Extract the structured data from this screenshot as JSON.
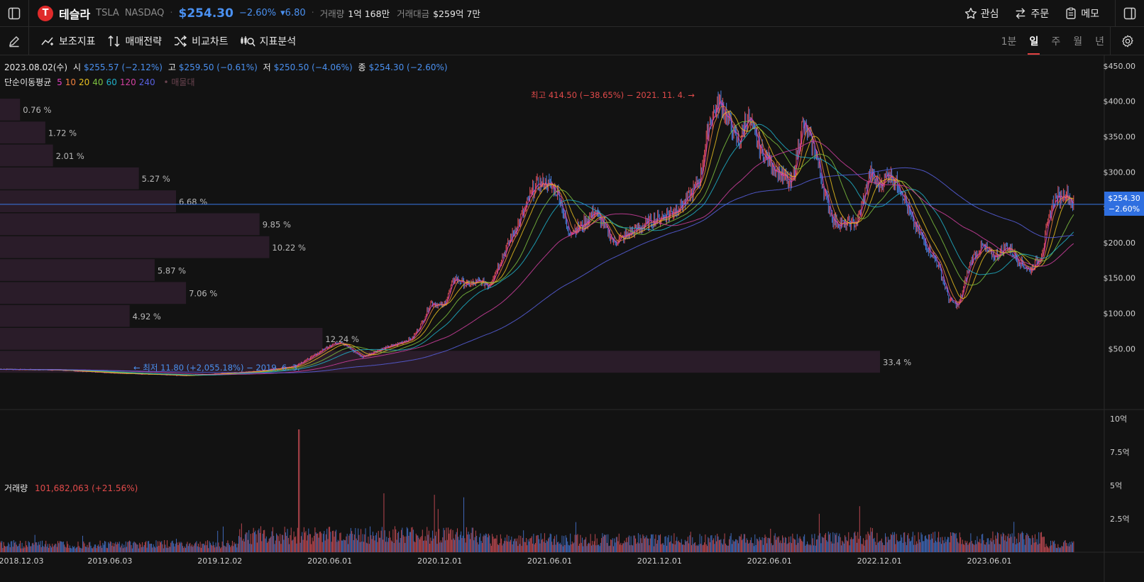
{
  "header": {
    "stock_name": "테슬라",
    "ticker": "TSLA",
    "exchange": "NASDAQ",
    "price": "$254.30",
    "change_pct": "−2.60%",
    "change_amt": "▾6.80",
    "volume_label": "거래량",
    "volume_value": "1억 168만",
    "amount_label": "거래대금",
    "amount_value": "$259억 7만",
    "actions": [
      "관심",
      "주문",
      "메모"
    ]
  },
  "toolbar": {
    "tools": [
      "보조지표",
      "매매전략",
      "비교차트",
      "지표분석"
    ],
    "timeframes": [
      "1분",
      "일",
      "주",
      "월",
      "년"
    ],
    "active_timeframe": "일"
  },
  "legend": {
    "date": "2023.08.02(수)",
    "open_label": "시",
    "open": "$255.57 (−2.12%)",
    "high_label": "고",
    "high": "$259.50 (−0.61%)",
    "low_label": "저",
    "low": "$250.50 (−4.06%)",
    "close_label": "종",
    "close": "$254.30 (−2.60%)",
    "ma_label": "단순이동평균",
    "ma_periods": [
      {
        "p": "5",
        "color": "#e040c0"
      },
      {
        "p": "10",
        "color": "#f0803c"
      },
      {
        "p": "20",
        "color": "#e8c020"
      },
      {
        "p": "40",
        "color": "#7cc040"
      },
      {
        "p": "60",
        "color": "#20b0c8"
      },
      {
        "p": "120",
        "color": "#d040a0"
      },
      {
        "p": "240",
        "color": "#5860e0"
      }
    ],
    "ma_extra": "• 매물대"
  },
  "annotations": {
    "high": "최고 414.50 (−38.65%) − 2021. 11. 4. →",
    "low": "← 최저 11.80 (+2,055.18%) − 2019. 6. 3."
  },
  "current_badge": {
    "price": "$254.30",
    "pct": "−2.60%"
  },
  "volume_legend": {
    "label": "거래량",
    "value": "101,682,063 (+21.56%)"
  },
  "chart_data": {
    "type": "candlestick",
    "price_axis": {
      "ticks": [
        "$450.00",
        "$400.00",
        "$350.00",
        "$300.00",
        "$250.00",
        "$200.00",
        "$150.00",
        "$100.00",
        "$50.00"
      ],
      "values": [
        450,
        400,
        350,
        300,
        250,
        200,
        150,
        100,
        50
      ],
      "range": [
        -35,
        465
      ]
    },
    "volume_axis": {
      "ticks": [
        "10억",
        "7.5억",
        "5억",
        "2.5억"
      ],
      "values": [
        1000,
        750,
        500,
        250
      ],
      "unit": "백만주"
    },
    "x_axis": {
      "labels": [
        "2018.12.03",
        "2019.06.03",
        "2019.12.02",
        "2020.06.01",
        "2020.12.01",
        "2021.06.01",
        "2021.12.01",
        "2022.06.01",
        "2022.12.01",
        "2023.06.01"
      ]
    },
    "close_path": [
      [
        0,
        21
      ],
      [
        3,
        20
      ],
      [
        6,
        16
      ],
      [
        8,
        14
      ],
      [
        10,
        12
      ],
      [
        12,
        15
      ],
      [
        14,
        18
      ],
      [
        16,
        25
      ],
      [
        17,
        38
      ],
      [
        18,
        55
      ],
      [
        18.6,
        60
      ],
      [
        19.2,
        48
      ],
      [
        19.8,
        38
      ],
      [
        20.5,
        47
      ],
      [
        21.5,
        55
      ],
      [
        22.5,
        65
      ],
      [
        23,
        85
      ],
      [
        23.5,
        115
      ],
      [
        24.2,
        110
      ],
      [
        24.8,
        150
      ],
      [
        25.5,
        140
      ],
      [
        26.2,
        145
      ],
      [
        26.7,
        140
      ],
      [
        27.5,
        185
      ],
      [
        28.5,
        240
      ],
      [
        29.2,
        280
      ],
      [
        29.8,
        285
      ],
      [
        30.5,
        270
      ],
      [
        31,
        215
      ],
      [
        31.8,
        225
      ],
      [
        32.5,
        245
      ],
      [
        33.5,
        200
      ],
      [
        34.5,
        215
      ],
      [
        35.5,
        230
      ],
      [
        36.5,
        240
      ],
      [
        37.5,
        260
      ],
      [
        38.2,
        290
      ],
      [
        38.7,
        370
      ],
      [
        39.3,
        400
      ],
      [
        39.8,
        370
      ],
      [
        40.3,
        340
      ],
      [
        40.8,
        380
      ],
      [
        41.5,
        330
      ],
      [
        42.5,
        300
      ],
      [
        43.2,
        280
      ],
      [
        43.8,
        370
      ],
      [
        44.5,
        330
      ],
      [
        45,
        270
      ],
      [
        45.5,
        230
      ],
      [
        46.2,
        225
      ],
      [
        46.8,
        230
      ],
      [
        47.5,
        300
      ],
      [
        48,
        280
      ],
      [
        48.5,
        300
      ],
      [
        49.2,
        275
      ],
      [
        49.8,
        230
      ],
      [
        50.5,
        200
      ],
      [
        51.2,
        170
      ],
      [
        51.8,
        120
      ],
      [
        52.3,
        110
      ],
      [
        53,
        175
      ],
      [
        53.6,
        195
      ],
      [
        54.3,
        180
      ],
      [
        55,
        195
      ],
      [
        55.6,
        175
      ],
      [
        56.2,
        160
      ],
      [
        56.8,
        180
      ],
      [
        57.5,
        260
      ],
      [
        58.2,
        270
      ],
      [
        58.6,
        254
      ]
    ],
    "date_axis_months": [
      0,
      6,
      12,
      18,
      24,
      30,
      36,
      42,
      48,
      54
    ],
    "vol_profile": [
      {
        "pct": "0.76 %",
        "value": 0.76
      },
      {
        "pct": "1.72 %",
        "value": 1.72
      },
      {
        "pct": "2.01 %",
        "value": 2.01
      },
      {
        "pct": "5.27 %",
        "value": 5.27
      },
      {
        "pct": "6.68 %",
        "value": 6.68
      },
      {
        "pct": "9.85 %",
        "value": 9.85
      },
      {
        "pct": "10.22 %",
        "value": 10.22
      },
      {
        "pct": "5.87 %",
        "value": 5.87
      },
      {
        "pct": "7.06 %",
        "value": 7.06
      },
      {
        "pct": "4.92 %",
        "value": 4.92
      },
      {
        "pct": "12.24 %",
        "value": 12.24
      },
      {
        "pct": "33.4 %",
        "value": 33.4
      }
    ],
    "current_price": 254.3
  }
}
